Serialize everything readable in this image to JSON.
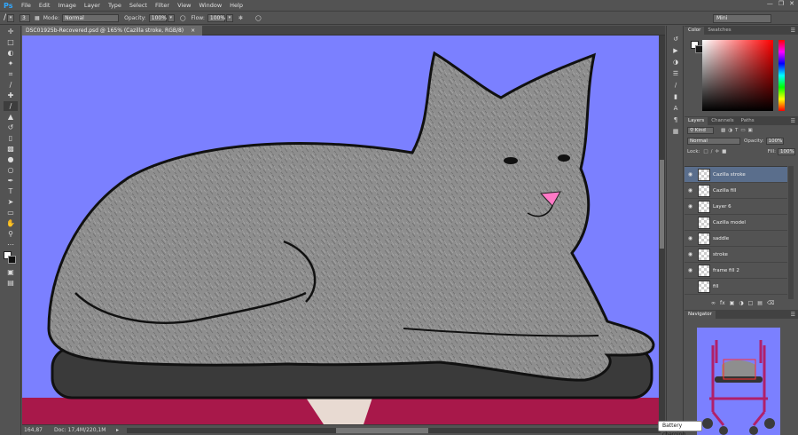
{
  "app": {
    "logo": "Ps"
  },
  "menu": [
    "File",
    "Edit",
    "Image",
    "Layer",
    "Type",
    "Select",
    "Filter",
    "View",
    "Window",
    "Help"
  ],
  "options": {
    "brush_size": "3",
    "mode_label": "Mode:",
    "mode_value": "Normal",
    "opacity_label": "Opacity:",
    "opacity_value": "100%",
    "flow_label": "Flow:",
    "flow_value": "100%",
    "workspace": "Mini"
  },
  "document": {
    "tab_title": "DSC01925b-Recovered.psd @ 165% (Cazilla stroke, RGB/8)",
    "zoom": "164,87",
    "doc_size": "Doc: 17,4M/220,1M"
  },
  "color_panel": {
    "tabs": [
      "Color",
      "Swatches"
    ],
    "foreground": "#ffffff",
    "background": "#1a1a1a"
  },
  "layers_panel": {
    "tabs": [
      "Layers",
      "Channels",
      "Paths"
    ],
    "kind_filter": "Kind",
    "blend_mode": "Normal",
    "opacity_label": "Opacity:",
    "opacity_value": "100%",
    "lock_label": "Lock:",
    "fill_label": "Fill:",
    "fill_value": "100%",
    "layers": [
      {
        "name": "Cazilla stroke",
        "visible": true,
        "selected": true
      },
      {
        "name": "Cazilla fill",
        "visible": true,
        "selected": false
      },
      {
        "name": "Layer 6",
        "visible": true,
        "selected": false
      },
      {
        "name": "Cazilla model",
        "visible": false,
        "selected": false
      },
      {
        "name": "saddle",
        "visible": true,
        "selected": false
      },
      {
        "name": "stroke",
        "visible": true,
        "selected": false
      },
      {
        "name": "frame fill 2",
        "visible": true,
        "selected": false
      },
      {
        "name": "fill",
        "visible": false,
        "selected": false
      }
    ]
  },
  "navigator": {
    "title": "Navigator"
  },
  "tooltip": "Battery charging",
  "colors": {
    "canvas_bg": "#7b80ff",
    "saddle": "#3a3a3a",
    "frame": "#a8184a",
    "cat_fur": "#8f8f8f",
    "nose": "#ff79c6"
  }
}
